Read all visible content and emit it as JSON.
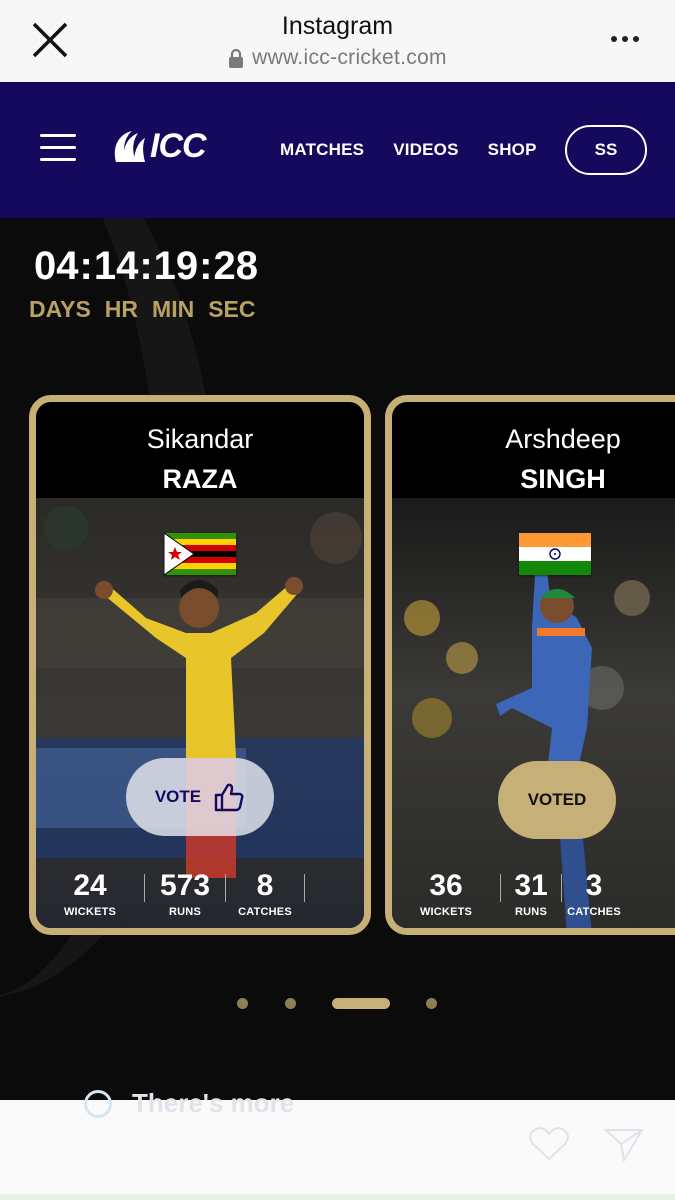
{
  "browser": {
    "title": "Instagram",
    "url": "www.icc-cricket.com",
    "close_icon": "close-icon",
    "more_icon": "more-dots-icon"
  },
  "header": {
    "logo_text": "ICC",
    "nav": [
      "MATCHES",
      "VIDEOS",
      "SHOP"
    ],
    "avatar_initials": "SS",
    "bg_color": "#14095c"
  },
  "countdown": {
    "days": "04",
    "hours": "14",
    "minutes": "19",
    "seconds": "28",
    "labels": [
      "DAYS",
      "HR",
      "MIN",
      "SEC"
    ]
  },
  "players": [
    {
      "first_name": "Sikandar",
      "last_name": "RAZA",
      "country_flag": "zimbabwe-flag",
      "vote_label": "VOTE",
      "vote_icon": "thumbs-up-icon",
      "stats": [
        {
          "value": "24",
          "label": "WICKETS"
        },
        {
          "value": "573",
          "label": "RUNS"
        },
        {
          "value": "8",
          "label": "CATCHES"
        }
      ]
    },
    {
      "first_name": "Arshdeep",
      "last_name": "SINGH",
      "country_flag": "india-flag",
      "vote_label": "VOTED",
      "stats": [
        {
          "value": "36",
          "label": "WICKETS"
        },
        {
          "value": "31",
          "label": "RUNS"
        },
        {
          "value": "3",
          "label": "CATCHES"
        }
      ]
    }
  ],
  "pagination": {
    "count": 4,
    "active_index": 2
  },
  "colors": {
    "gold": "#c6b078",
    "navy": "#14095c",
    "dark_bg": "#0b0b0b"
  },
  "bottom": {
    "ghost_text": "There's more"
  }
}
